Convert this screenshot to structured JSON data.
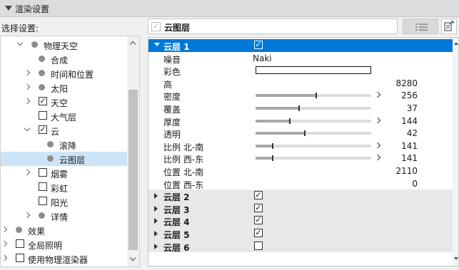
{
  "header": {
    "title": "渲染设置"
  },
  "left": {
    "select_label": "选择设置:",
    "tree": [
      {
        "label": "物理天空",
        "kind": "dot",
        "chevron": "down",
        "level": 0
      },
      {
        "label": "合成",
        "kind": "dot",
        "chevron": "none",
        "level": 1
      },
      {
        "label": "时间和位置",
        "kind": "dot",
        "chevron": "right",
        "level": 1
      },
      {
        "label": "太阳",
        "kind": "dot",
        "chevron": "right",
        "level": 1
      },
      {
        "label": "天空",
        "kind": "checkbox",
        "checked": true,
        "chevron": "right",
        "level": 1
      },
      {
        "label": "大气层",
        "kind": "checkbox",
        "checked": false,
        "chevron": "none",
        "level": 1
      },
      {
        "label": "云",
        "kind": "checkbox",
        "checked": true,
        "chevron": "down",
        "level": 1
      },
      {
        "label": "滚降",
        "kind": "dot",
        "chevron": "none",
        "level": 2
      },
      {
        "label": "云图层",
        "kind": "dot",
        "chevron": "none",
        "level": 2,
        "selected": true
      },
      {
        "label": "烟雾",
        "kind": "checkbox",
        "checked": false,
        "chevron": "right",
        "level": 1
      },
      {
        "label": "彩虹",
        "kind": "checkbox",
        "checked": false,
        "chevron": "none",
        "level": 1
      },
      {
        "label": "阳光",
        "kind": "checkbox",
        "checked": false,
        "chevron": "none",
        "level": 1
      },
      {
        "label": "详情",
        "kind": "dot",
        "chevron": "right",
        "level": 1
      },
      {
        "label": "效果",
        "kind": "dot",
        "chevron": "right",
        "level": -1
      },
      {
        "label": "全局照明",
        "kind": "checkbox",
        "checked": false,
        "chevron": "right",
        "level": -1
      },
      {
        "label": "使用物理渲染器",
        "kind": "checkbox",
        "checked": false,
        "chevron": "right",
        "level": -1
      }
    ]
  },
  "right": {
    "title": "云图层",
    "rows": [
      {
        "type": "head",
        "label": "云层 1",
        "checked": true
      },
      {
        "type": "text",
        "label": "噪音",
        "text": "Naki"
      },
      {
        "type": "color",
        "label": "彩色"
      },
      {
        "type": "value",
        "label": "高",
        "value": "8280"
      },
      {
        "type": "slider",
        "label": "密度",
        "value": "256",
        "fill": 0.52,
        "arrow": true
      },
      {
        "type": "slider",
        "label": "覆盖",
        "value": "37",
        "fill": 0.37,
        "arrow": false
      },
      {
        "type": "slider",
        "label": "厚度",
        "value": "144",
        "fill": 0.29,
        "arrow": true
      },
      {
        "type": "slider",
        "label": "透明",
        "value": "42",
        "fill": 0.42,
        "arrow": false
      },
      {
        "type": "slider",
        "label": "比例 北-南",
        "value": "141",
        "fill": 0.14,
        "arrow": true
      },
      {
        "type": "slider",
        "label": "比例 西-东",
        "value": "141",
        "fill": 0.14,
        "arrow": true
      },
      {
        "type": "value",
        "label": "位置 北-南",
        "value": "2110"
      },
      {
        "type": "value",
        "label": "位置 西-东",
        "value": "0"
      },
      {
        "type": "group",
        "label": "云层 2",
        "checked": true
      },
      {
        "type": "group",
        "label": "云层 3",
        "checked": true
      },
      {
        "type": "group",
        "label": "云层 4",
        "checked": true
      },
      {
        "type": "group",
        "label": "云层 5",
        "checked": true
      },
      {
        "type": "group",
        "label": "云层 6",
        "checked": false
      }
    ]
  },
  "colors": {
    "selection": "#0078d7",
    "tree_selected": "#cce4f7",
    "accent_text": "#ffffff"
  }
}
